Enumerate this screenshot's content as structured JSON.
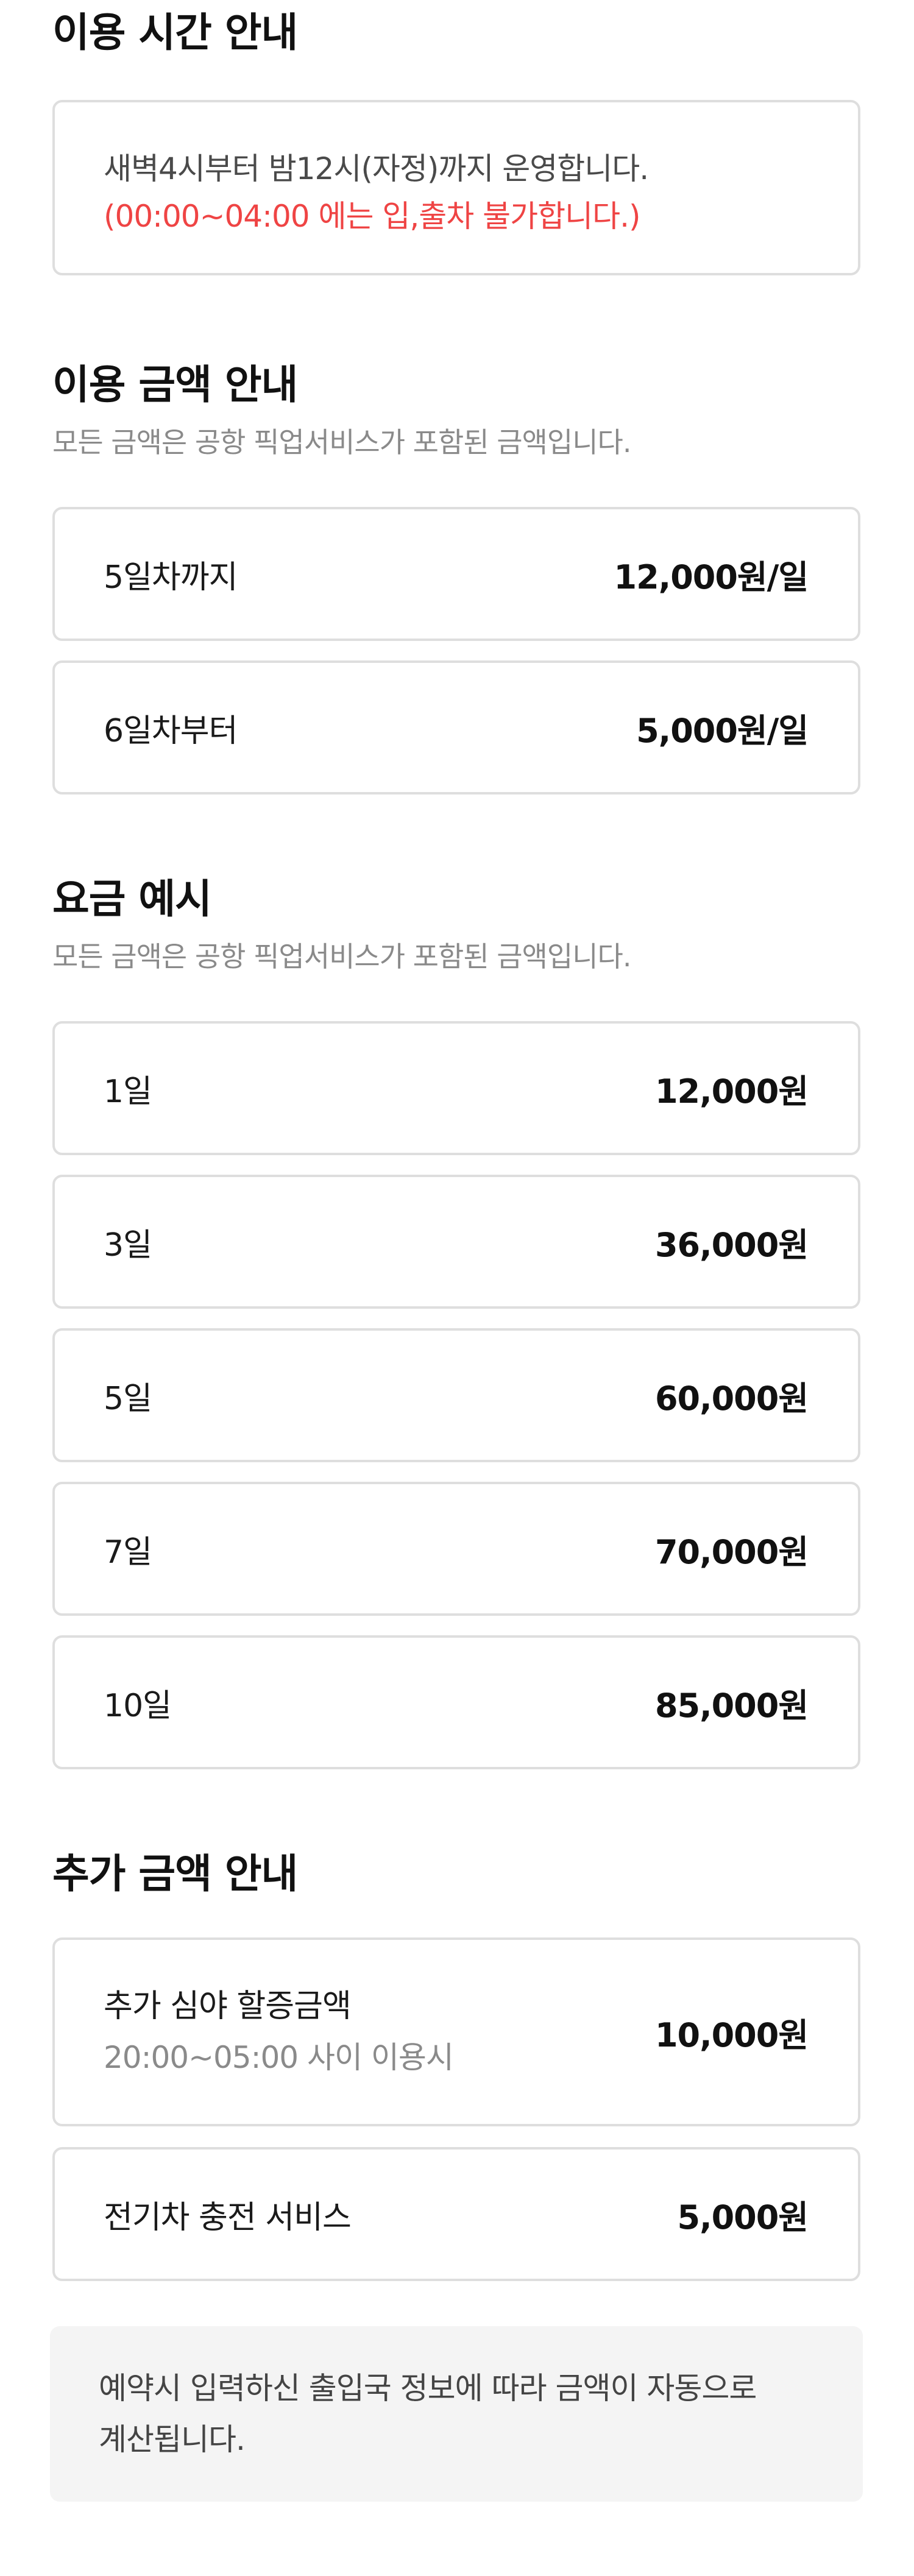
{
  "hours": {
    "title": "이용 시간 안내",
    "line1": "새벽4시부터 밤12시(자정)까지 운영합니다.",
    "line2": "(00:00~04:00 에는 입,출차 불가합니다.)",
    "line2_color": "#ef4444"
  },
  "pricing": {
    "title": "이용 금액 안내",
    "subtitle": "모든 금액은 공항 픽업서비스가 포함된 금액입니다.",
    "rows": [
      {
        "label": "5일차까지",
        "value": "12,000원/일"
      },
      {
        "label": "6일차부터",
        "value": "5,000원/일"
      }
    ]
  },
  "examples": {
    "title": "요금 예시",
    "subtitle": "모든 금액은 공항 픽업서비스가 포함된 금액입니다.",
    "rows": [
      {
        "label": "1일",
        "value": "12,000원"
      },
      {
        "label": "3일",
        "value": "36,000원"
      },
      {
        "label": "5일",
        "value": "60,000원"
      },
      {
        "label": "7일",
        "value": "70,000원"
      },
      {
        "label": "10일",
        "value": "85,000원"
      }
    ]
  },
  "extras": {
    "title": "추가 금액 안내",
    "night": {
      "label": "추가 심야 할증금액",
      "note": "20:00~05:00 사이 이용시",
      "value": "10,000원"
    },
    "ev": {
      "label": "전기차 충전 서비스",
      "value": "5,000원"
    }
  },
  "notice": {
    "line1": "예약시 입력하신 출입국 정보에 따라 금액이 자동으로",
    "line2": "계산됩니다."
  }
}
